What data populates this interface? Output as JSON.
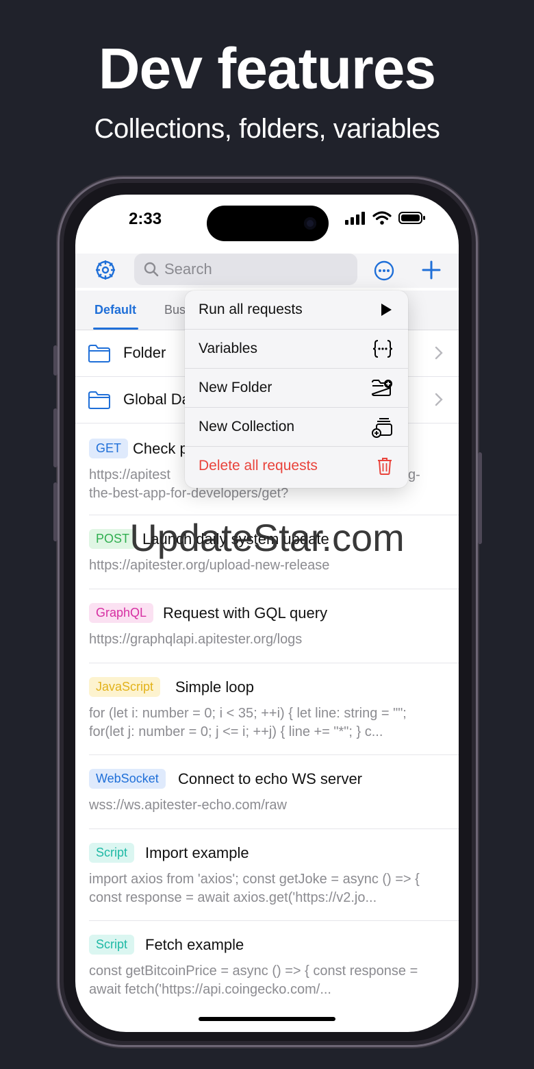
{
  "headline": "Dev features",
  "subheadline": "Collections, folders, variables",
  "status": {
    "time": "2:33"
  },
  "toolbar": {
    "search_placeholder": "Search"
  },
  "tabs": [
    {
      "label": "Default",
      "active": true
    },
    {
      "label": "Bus",
      "active": false
    }
  ],
  "folders": [
    {
      "label": "Folder"
    },
    {
      "label": "Global Da"
    }
  ],
  "requests": [
    {
      "method": "GET",
      "name": "Check p",
      "detail": "https://apitest",
      "detail2": "the-best-app-for-developers/get?",
      "detail_tail": "g-"
    },
    {
      "method": "POST",
      "name": "Launch daily system update",
      "detail": "https://apitester.org/upload-new-release"
    },
    {
      "method": "GraphQL",
      "name": "Request with GQL query",
      "detail": "https://graphqlapi.apitester.org/logs"
    },
    {
      "method": "JavaScript",
      "name": "Simple loop",
      "detail": "for (let i: number = 0; i < 35; ++i) { let line: string = \"\"; for(let j: number = 0; j <= i; ++j) { line += \"*\"; } c..."
    },
    {
      "method": "WebSocket",
      "name": "Connect to echo WS server",
      "detail": "wss://ws.apitester-echo.com/raw"
    },
    {
      "method": "Script",
      "name": "Import example",
      "detail": "import axios from 'axios'; const getJoke = async () => { const response = await axios.get('https://v2.jo..."
    },
    {
      "method": "Script",
      "name": "Fetch example",
      "detail": "const getBitcoinPrice = async () => { const response = await fetch('https://api.coingecko.com/..."
    }
  ],
  "menu": {
    "items": [
      {
        "label": "Run all requests",
        "icon": "play-icon"
      },
      {
        "label": "Variables",
        "icon": "braces-icon"
      },
      {
        "label": "New Folder",
        "icon": "folder-plus-icon"
      },
      {
        "label": "New Collection",
        "icon": "collection-plus-icon"
      },
      {
        "label": "Delete all requests",
        "icon": "trash-icon"
      }
    ]
  },
  "watermark": "UpdateStar.com",
  "colors": {
    "accent": "#1f6fd8",
    "danger": "#e9433b",
    "get_bg": "#dfeafc",
    "get_fg": "#1f6fd8",
    "post_bg": "#e0f6e4",
    "post_fg": "#2fae4f",
    "gql_bg": "#fbe1f2",
    "gql_fg": "#d62fa2",
    "js_bg": "#fdf3cf",
    "js_fg": "#e2b21a",
    "ws_bg": "#dfeafc",
    "ws_fg": "#1f6fd8",
    "script_bg": "#dbf6f1",
    "script_fg": "#1eb9a5"
  }
}
